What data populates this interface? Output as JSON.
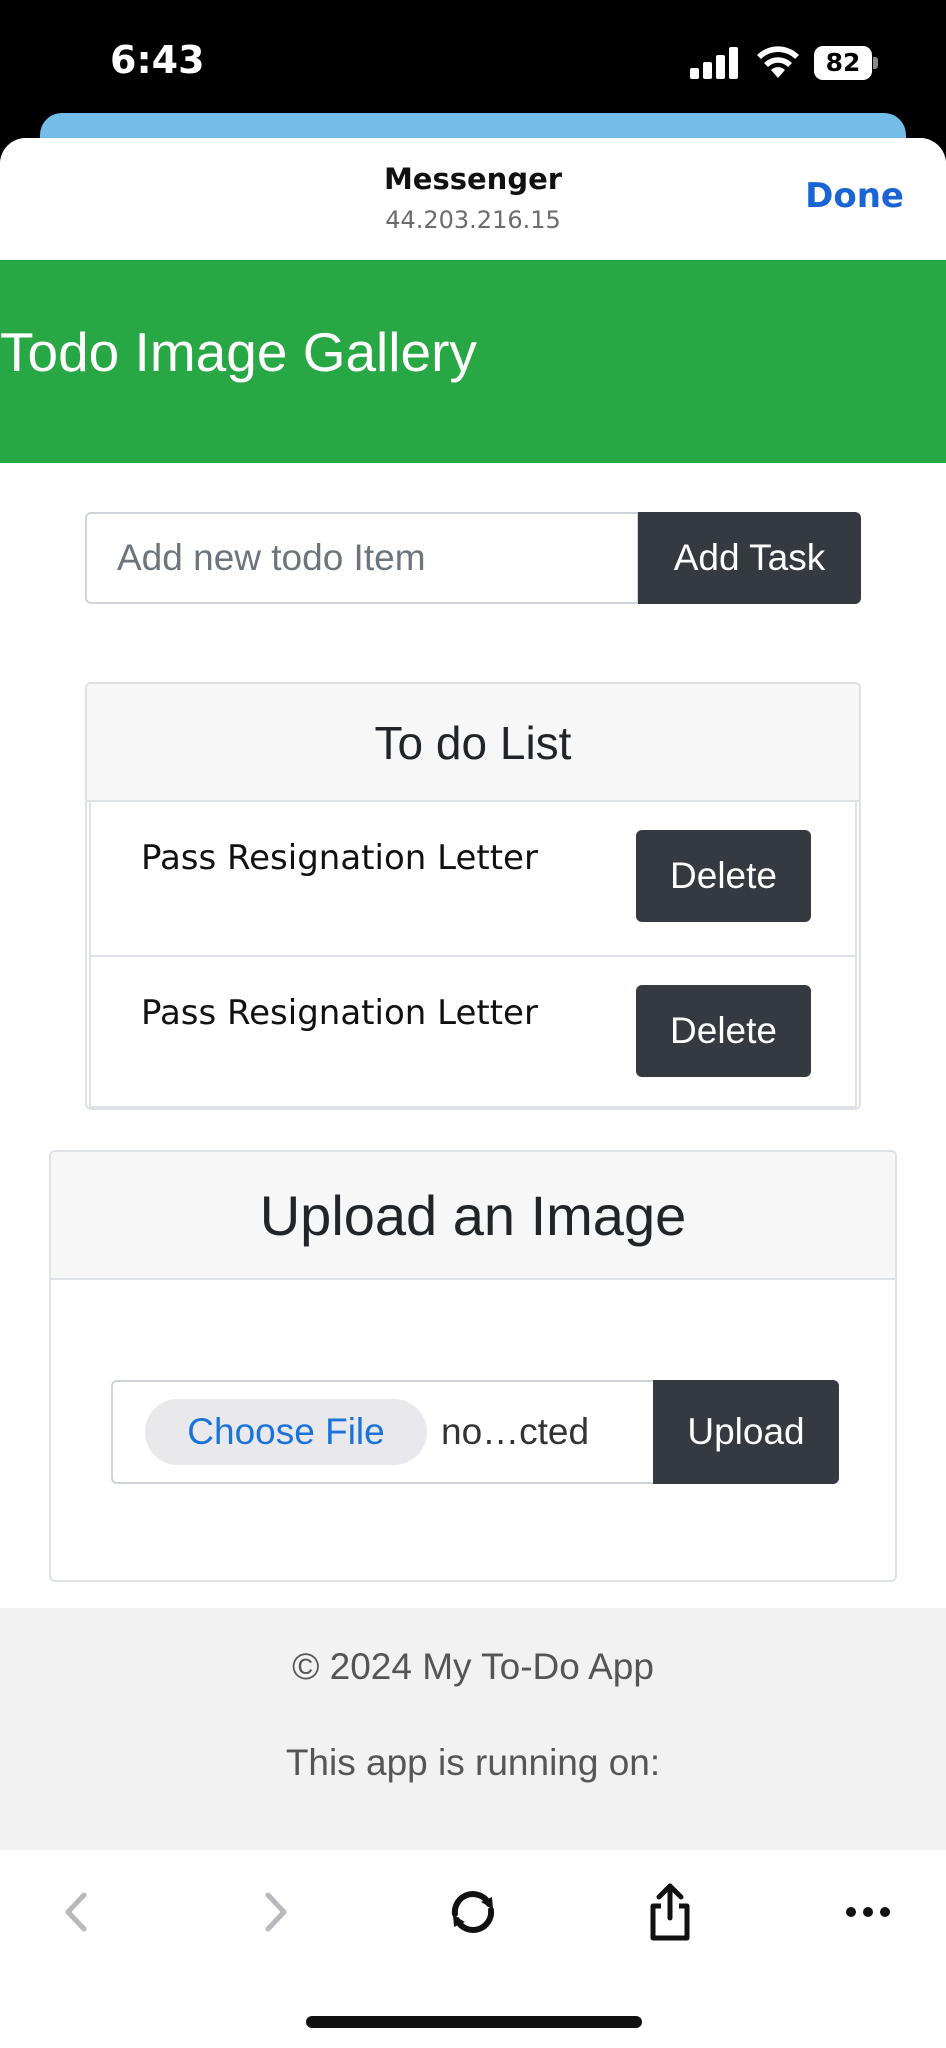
{
  "status_bar": {
    "time": "6:43",
    "battery": "82",
    "icons": [
      "signal-icon",
      "wifi-icon",
      "battery-icon"
    ]
  },
  "browser": {
    "title": "Messenger",
    "address": "44.203.216.15",
    "done_label": "Done"
  },
  "app": {
    "title": "Todo Image Gallery",
    "header_color": "#28a745",
    "button_color": "#343a40"
  },
  "todo_form": {
    "input_placeholder": "Add new todo Item",
    "input_value": "",
    "add_button": "Add Task"
  },
  "todo_list": {
    "heading": "To do List",
    "items": [
      {
        "text": "Pass Resignation Letter",
        "delete_label": "Delete"
      },
      {
        "text": "Pass Resignation Letter",
        "delete_label": "Delete"
      }
    ]
  },
  "upload": {
    "heading": "Upload an Image",
    "choose_file_label": "Choose File",
    "file_status": "no…cted",
    "upload_button": "Upload"
  },
  "footer": {
    "copyright": "© 2024 My To-Do App",
    "running_on": "This app is running on:"
  },
  "toolbar": {
    "icons": [
      "back-arrow-icon",
      "forward-arrow-icon",
      "reload-icon",
      "share-icon",
      "more-options-icon"
    ]
  }
}
